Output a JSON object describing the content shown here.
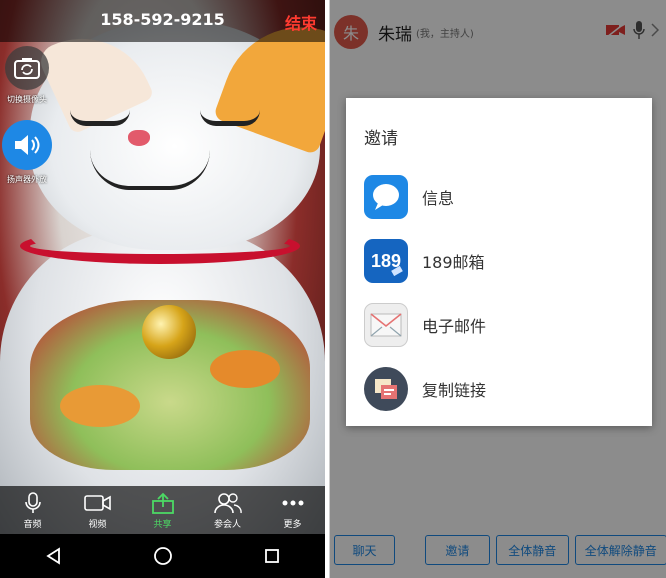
{
  "left": {
    "phone_number": "158-592-9215",
    "end_label": "结束",
    "side": {
      "camera_switch_label": "切换摄像头",
      "speaker_label": "扬声器外放"
    },
    "toolbar": {
      "items": [
        {
          "label": "音频",
          "icon": "microphone-icon"
        },
        {
          "label": "视频",
          "icon": "video-camera-icon"
        },
        {
          "label": "共享",
          "icon": "share-upload-icon"
        },
        {
          "label": "参会人",
          "icon": "participants-icon"
        },
        {
          "label": "更多",
          "icon": "more-dots-icon"
        }
      ]
    },
    "nav": [
      "back-nav-icon",
      "home-nav-icon",
      "recents-nav-icon"
    ]
  },
  "right": {
    "participant": {
      "avatar_char": "朱",
      "name": "朱瑞",
      "role": "(我，主持人)"
    },
    "invite_dialog": {
      "title": "邀请",
      "items": [
        {
          "label": "信息",
          "icon": "messages-app-icon",
          "color": "#1e88e5"
        },
        {
          "label": "189邮箱",
          "icon": "mail-189-app-icon",
          "color": "#1565c0"
        },
        {
          "label": "电子邮件",
          "icon": "email-app-icon",
          "color": "#eeeeee"
        },
        {
          "label": "复制链接",
          "icon": "copy-link-icon",
          "color": "#3f4a5a"
        }
      ]
    },
    "actions": {
      "chat": "聊天",
      "invite": "邀请",
      "mute_all": "全体静音",
      "unmute_all": "全体解除静音"
    }
  },
  "colors": {
    "accent_blue": "#1e88e5",
    "end_red": "#ff3b30",
    "share_green": "#4cd964",
    "avatar_red": "#e25a4b"
  }
}
